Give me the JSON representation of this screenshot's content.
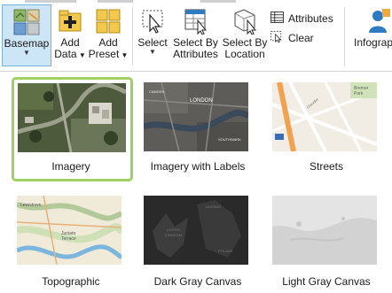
{
  "ribbon": {
    "basemap_label": "Basemap",
    "add_data_label_1": "Add",
    "add_data_label_2": "Data",
    "add_preset_label_1": "Add",
    "add_preset_label_2": "Preset",
    "select_label": "Select",
    "select_by_attributes_label_1": "Select By",
    "select_by_attributes_label_2": "Attributes",
    "select_by_location_label_1": "Select By",
    "select_by_location_label_2": "Location",
    "attributes_label": "Attributes",
    "clear_label": "Clear",
    "infographics_label": "Infograph"
  },
  "gallery": {
    "items": [
      {
        "label": "Imagery",
        "selected": true
      },
      {
        "label": "Imagery with Labels",
        "selected": false
      },
      {
        "label": "Streets",
        "selected": false
      },
      {
        "label": "Topographic",
        "selected": false
      },
      {
        "label": "Dark Gray Canvas",
        "selected": false
      },
      {
        "label": "Light Gray Canvas",
        "selected": false
      }
    ]
  },
  "colors": {
    "selection_border": "#9fd061",
    "active_button_bg": "#cde6f7",
    "accent_blue": "#2f7bbf"
  }
}
